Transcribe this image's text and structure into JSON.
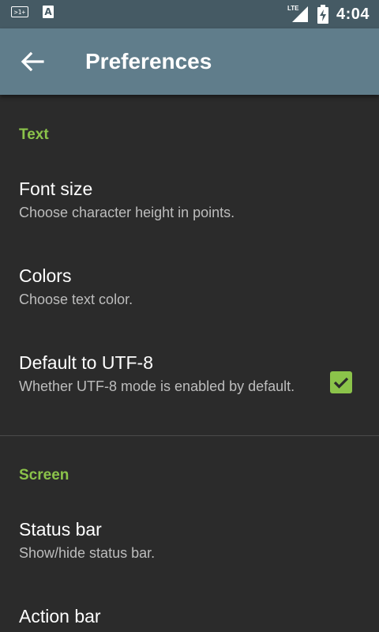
{
  "status_bar": {
    "left_icons": [
      "terminal-icon",
      "font-a-icon"
    ],
    "term_text": ">1+",
    "font_text": "A",
    "network_label": "LTE",
    "time": "4:04"
  },
  "app_bar": {
    "title": "Preferences",
    "back_icon": "arrow-back-icon",
    "color": "#607d8b"
  },
  "sections": [
    {
      "category": "Text",
      "items": [
        {
          "title": "Font size",
          "summary": "Choose character height in points."
        },
        {
          "title": "Colors",
          "summary": "Choose text color."
        },
        {
          "title": "Default to UTF-8",
          "summary": "Whether UTF-8 mode is enabled by default.",
          "checked": true
        }
      ]
    },
    {
      "category": "Screen",
      "items": [
        {
          "title": "Status bar",
          "summary": "Show/hide status bar."
        },
        {
          "title": "Action bar",
          "summary": ""
        }
      ]
    }
  ],
  "accent_color": "#8bc34a"
}
